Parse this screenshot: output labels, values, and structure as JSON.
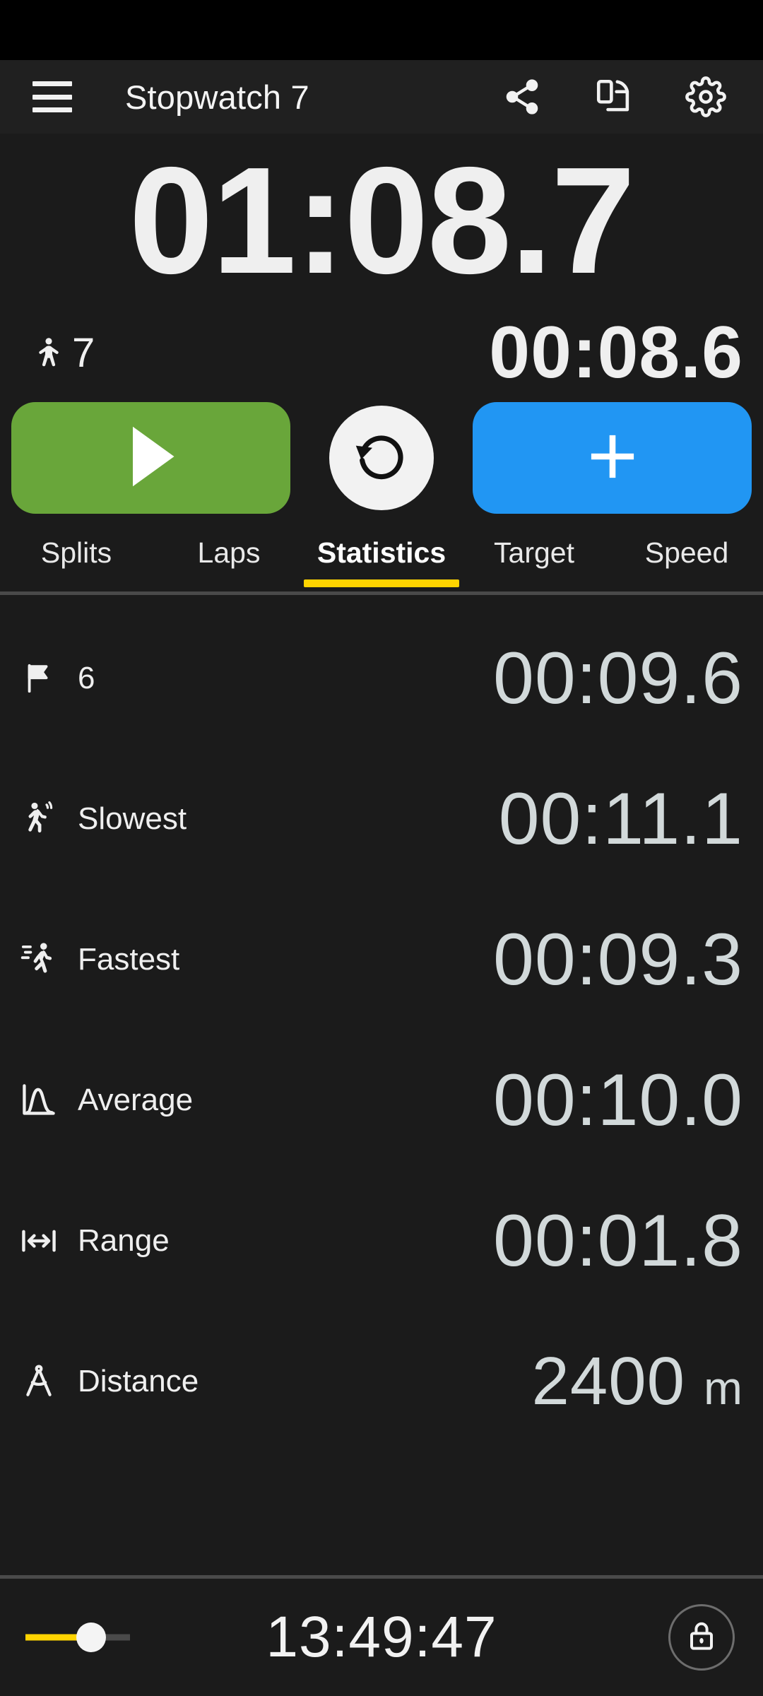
{
  "appbar": {
    "menu_icon": "hamburger-menu-icon",
    "title": "Stopwatch 7",
    "actions": [
      {
        "name": "share-icon",
        "label": "Share"
      },
      {
        "name": "split-screen-icon",
        "label": "Split screen"
      },
      {
        "name": "gear-icon",
        "label": "Settings"
      }
    ]
  },
  "timer": {
    "main": "01:08.7",
    "main_hours_minutes": "01",
    "main_separator": ":",
    "main_seconds": "08",
    "main_fraction": ".7",
    "lap_icon": "person-icon",
    "lap_count": "7",
    "lap_time": "00:08.6"
  },
  "controls": {
    "start": {
      "name": "start-button",
      "icon": "play-icon",
      "color": "#69a63a"
    },
    "reset": {
      "name": "reset-button",
      "icon": "reset-icon",
      "color": "#f2f2f2"
    },
    "add": {
      "name": "add-lap-button",
      "icon": "plus-icon",
      "color": "#2196f3"
    }
  },
  "tabs": {
    "active_index": 2,
    "indicator_color": "#ffd400",
    "items": [
      {
        "label": "Splits"
      },
      {
        "label": "Laps"
      },
      {
        "label": "Statistics"
      },
      {
        "label": "Target"
      },
      {
        "label": "Speed"
      }
    ]
  },
  "statistics": {
    "rows": [
      {
        "icon": "flag-icon",
        "label": "6",
        "value": "00:09.6",
        "unit": ""
      },
      {
        "icon": "walking-icon",
        "label": "Slowest",
        "value": "00:11.1",
        "unit": ""
      },
      {
        "icon": "running-icon",
        "label": "Fastest",
        "value": "00:09.3",
        "unit": ""
      },
      {
        "icon": "curve-chart-icon",
        "label": "Average",
        "value": "00:10.0",
        "unit": ""
      },
      {
        "icon": "range-arrows-icon",
        "label": "Range",
        "value": "00:01.8",
        "unit": ""
      },
      {
        "icon": "compass-divider-icon",
        "label": "Distance",
        "value": "2400",
        "unit": "m"
      }
    ]
  },
  "bottombar": {
    "brightness_label": "Brightness",
    "brightness_value": "58",
    "clock": "13:49:47",
    "lock_icon": "lock-icon"
  },
  "colors": {
    "background": "#1b1b1b",
    "appbar": "#202020",
    "accent_yellow": "#ffd400",
    "green": "#69a63a",
    "blue": "#2196f3",
    "value_text": "#d2d9da"
  }
}
